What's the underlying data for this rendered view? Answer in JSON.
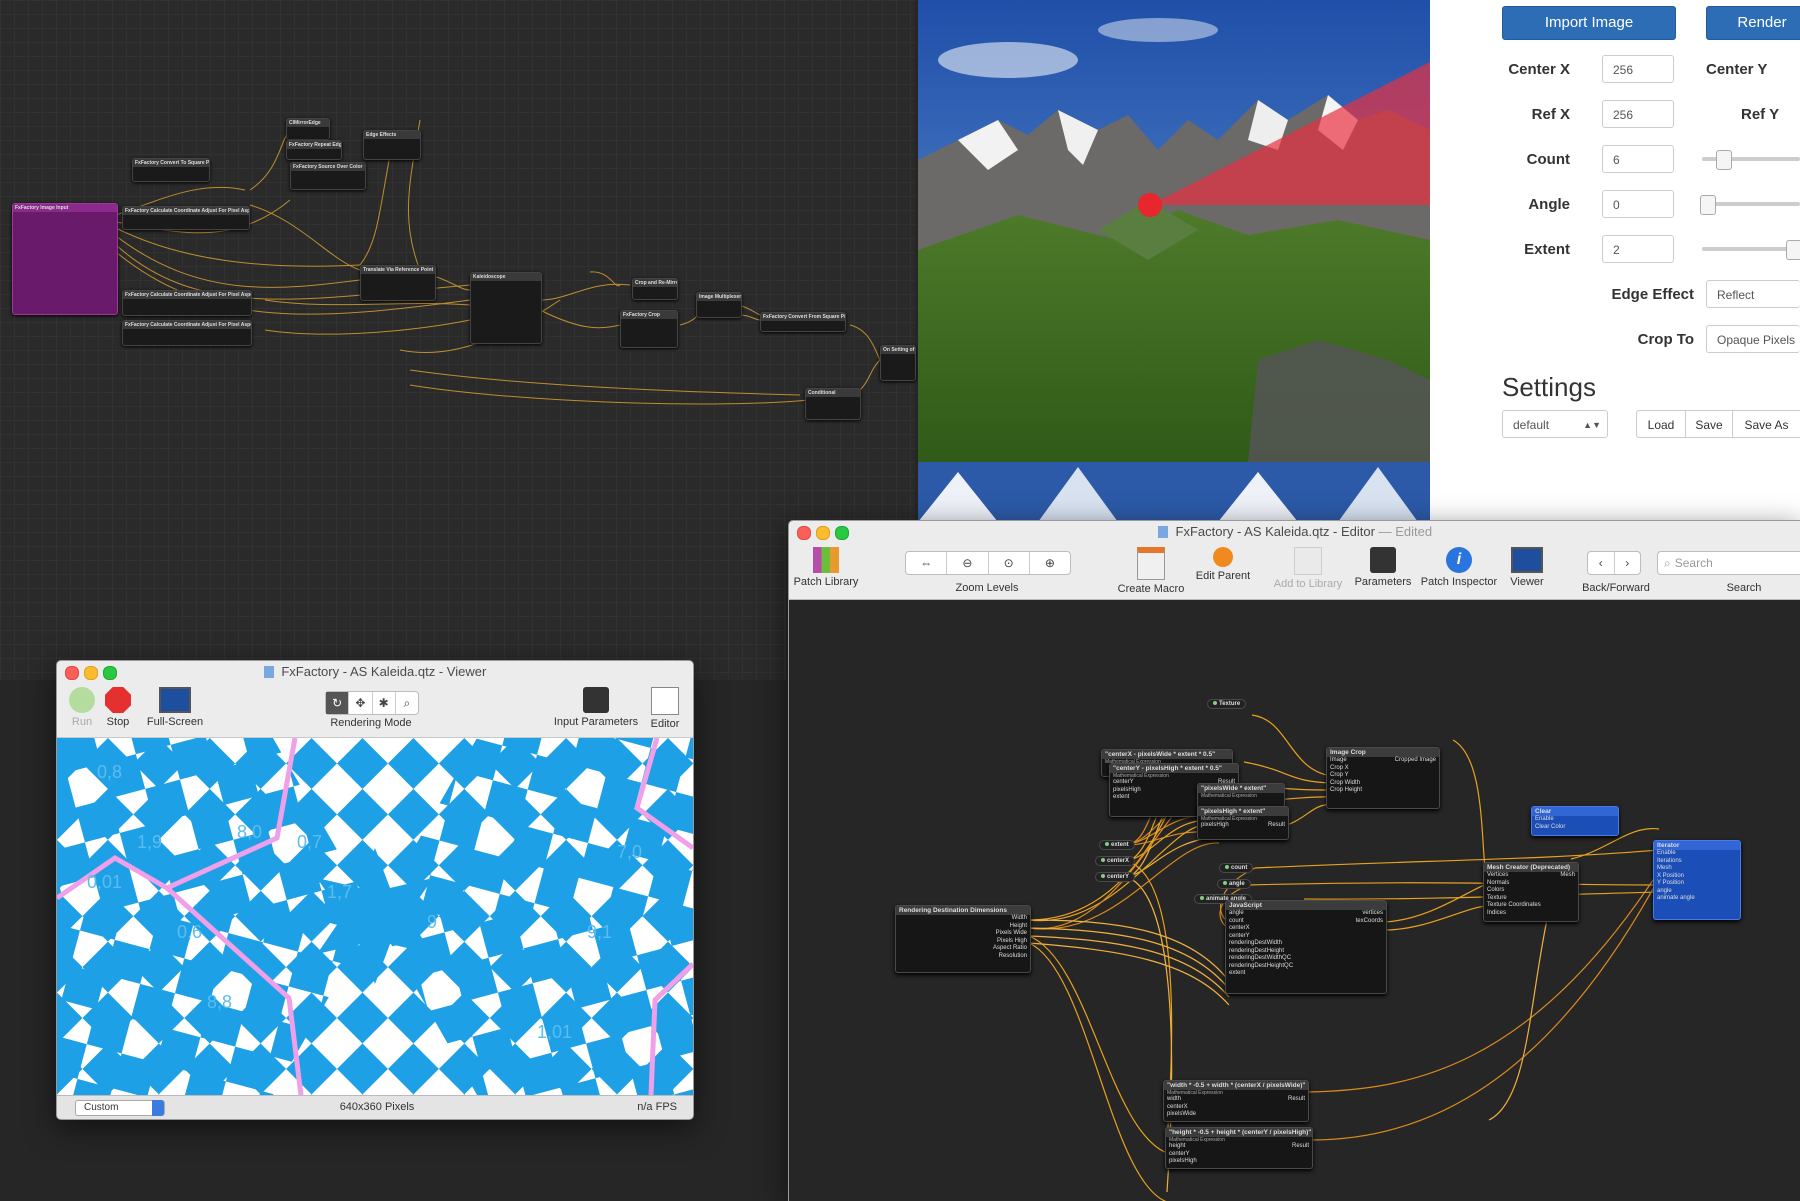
{
  "background_graph": {
    "input_node": {
      "title": "FxFactory Image Input",
      "left_ports": [
        "\"Image\"",
        "\"Image_Info\""
      ],
      "right_ports": [
        "Image",
        "Pixels Wide",
        "Pixels High",
        "Center X",
        "Center Y",
        "Ref X",
        "Ref Y",
        "Pixel Aspect Ratio",
        "Display Aspect Ratio",
        "Pixel Order",
        "Field",
        "Pixel Format",
        "Bits per Component",
        "Scale Factor",
        "Start Frame",
        "Duration"
      ]
    },
    "nodes": [
      "FxFactory Convert To Square Pixels",
      "FxFactory Calculate Coordinate Adjust For Pixel Aspect Ratio",
      "CIMirrorEdge",
      "FxFactory Repeat Edges",
      "FxFactory Source Over Color",
      "Edge Effects",
      "Translate Via Reference Point",
      "Kaleidoscope",
      "Crop and Re-Mirror",
      "FxFactory Crop",
      "Image Multiplexer",
      "FxFactory Convert From Square Pixels",
      "On Setting of Crop",
      "Conditional",
      "FxFactory Calculate Coordinate Adjust For Pixel Aspect Ratio",
      "FxFactory Calculate Coordinate Adjust For Pixel Aspect Ratio"
    ],
    "pills": [
      "Image",
      "Pixels Wide",
      "Pixels High",
      "Reference (X)",
      "Reference (Y)",
      "Center (X)",
      "Center (Y)",
      "Angle",
      "Count",
      "Extent",
      "Animate Angle",
      "Size"
    ]
  },
  "params_panel": {
    "import_button": "Import Image",
    "render_button": "Render",
    "fields": [
      {
        "label": "Center X",
        "value": "256"
      },
      {
        "label": "Ref X",
        "value": "256"
      },
      {
        "label": "Count",
        "value": "6"
      },
      {
        "label": "Angle",
        "value": "0"
      },
      {
        "label": "Extent",
        "value": "2"
      }
    ],
    "right_labels": {
      "center_y": "Center Y",
      "ref_y": "Ref Y"
    },
    "sliders": {
      "count": 0.15,
      "angle": 0.05,
      "extent": 1.0
    },
    "edge_effect": {
      "label": "Edge Effect",
      "value": "Reflect"
    },
    "crop_to": {
      "label": "Crop To",
      "value": "Opaque Pixels"
    },
    "settings_title": "Settings",
    "settings_select": "default",
    "load": "Load",
    "save": "Save",
    "save_as": "Save As"
  },
  "viewer_window": {
    "title": "FxFactory - AS Kaleida.qtz - Viewer",
    "toolbar": {
      "run": "Run",
      "stop": "Stop",
      "fullscreen": "Full-Screen",
      "rendering_mode": "Rendering Mode",
      "input_parameters": "Input Parameters",
      "editor": "Editor"
    },
    "status": {
      "size_select": "Custom",
      "pixels": "640x360 Pixels",
      "fps": "n/a FPS"
    },
    "canvas_labels": [
      "0,8",
      "1,9",
      "7,0",
      "0,01",
      "8,0",
      "9,1",
      "0,7",
      "1,7",
      "8,8",
      "1,01",
      "9",
      "0,6"
    ]
  },
  "editor_window": {
    "title": "FxFactory - AS Kaleida.qtz - Editor",
    "title_status": "Edited",
    "toolbar": {
      "patch_library": "Patch Library",
      "zoom_levels": "Zoom Levels",
      "create_macro": "Create Macro",
      "edit_parent": "Edit Parent",
      "add_to_library": "Add to Library",
      "parameters": "Parameters",
      "patch_inspector": "Patch Inspector",
      "viewer": "Viewer",
      "back_forward": "Back/Forward",
      "search_label": "Search",
      "search_placeholder": "Search"
    },
    "nodes": {
      "texture": "Texture",
      "mathA": {
        "title": "\"centerX - pixelsWide * extent * 0.5\"",
        "sub": "Mathematical Expression",
        "in": [
          "centerX",
          "pixelsWide",
          "extent"
        ],
        "out": "Result"
      },
      "mathB": {
        "title": "\"centerY - pixelsHigh * extent * 0.5\"",
        "sub": "Mathematical Expression",
        "in": [
          "centerY",
          "pixelsHigh",
          "extent"
        ],
        "out": "Result"
      },
      "mathC": {
        "title": "\"pixelsWide * extent\"",
        "sub": "Mathematical Expression",
        "in": [
          "pixelsWide",
          "extent"
        ],
        "out": "Result"
      },
      "mathD": {
        "title": "\"pixelsHigh * extent\"",
        "sub": "Mathematical Expression",
        "in": [
          "pixelsHigh",
          "extent"
        ],
        "out": "Result"
      },
      "crop": {
        "title": "Image Crop",
        "in": [
          "Image",
          "Crop X",
          "Crop Y",
          "Crop Width",
          "Crop Height"
        ],
        "out": "Cropped Image"
      },
      "clear": {
        "title": "Clear",
        "in": [
          "Enable",
          "Clear Color"
        ]
      },
      "iterator": {
        "title": "Iterator",
        "in": [
          "Enable",
          "Iterations",
          "Mesh",
          "X Position",
          "Y Position",
          "angle",
          "animate angle"
        ]
      },
      "pills_left": [
        "extent",
        "centerX",
        "centerY"
      ],
      "pills_mid": [
        "count",
        "angle",
        "animate angle"
      ],
      "rdd": {
        "title": "Rendering Destination Dimensions",
        "out": [
          "Width",
          "Height",
          "Pixels Wide",
          "Pixels High",
          "Aspect Ratio",
          "Resolution"
        ]
      },
      "js": {
        "title": "JavaScript",
        "in": [
          "angle",
          "count",
          "centerX",
          "centerY",
          "renderingDestWidth",
          "renderingDestHeight",
          "renderingDestWidthQC",
          "renderingDestHeightQC",
          "extent"
        ],
        "out": [
          "vertices",
          "texCoords"
        ]
      },
      "mesh": {
        "title": "Mesh Creator (Deprecated)",
        "in": [
          "Vertices",
          "Normals",
          "Colors",
          "Texture",
          "Texture Coordinates",
          "Indices"
        ],
        "out": "Mesh"
      },
      "mathE": {
        "title": "\"width * -0.5 + width * (centerX / pixelsWide)\"",
        "sub": "Mathematical Expression",
        "in": [
          "width",
          "centerX",
          "pixelsWide"
        ],
        "out": "Result"
      },
      "mathF": {
        "title": "\"height * -0.5 + height * (centerY / pixelsHigh)\"",
        "sub": "Mathematical Expression",
        "in": [
          "height",
          "centerY",
          "pixelsHigh"
        ],
        "out": "Result"
      }
    }
  },
  "colors": {
    "accent_blue": "#2d6db5",
    "kaleido_blue": "#1ea0e6",
    "kaleido_pink": "#f0a0e8",
    "wire_orange": "#e8a21e",
    "marker_red": "#e8262e"
  }
}
